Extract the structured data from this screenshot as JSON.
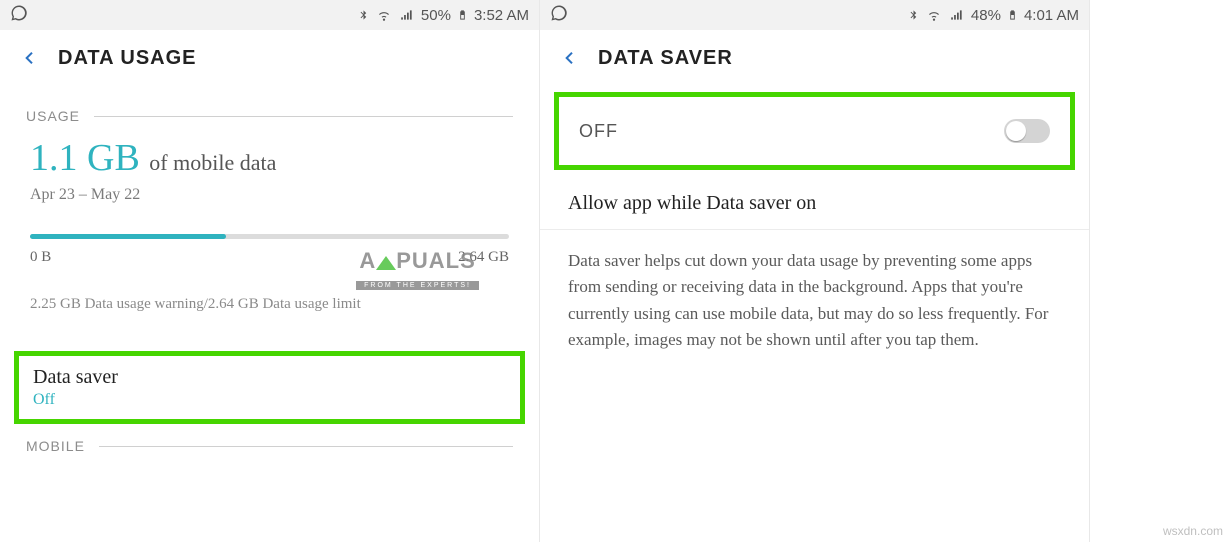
{
  "left": {
    "statusbar": {
      "battery_pct": "50%",
      "time": "3:52 AM"
    },
    "title": "DATA USAGE",
    "sections": {
      "usage_header": "USAGE",
      "mobile_header": "MOBILE"
    },
    "usage": {
      "amount": "1.1 GB",
      "of_label": " of mobile data",
      "range": "Apr 23 – May 22",
      "bar_min": "0 B",
      "bar_max": "2.64 GB",
      "warning_line": "2.25 GB Data usage warning/2.64 GB Data usage limit"
    },
    "data_saver_row": {
      "title": "Data saver",
      "status": "Off"
    }
  },
  "right": {
    "statusbar": {
      "battery_pct": "48%",
      "time": "4:01 AM"
    },
    "title": "DATA SAVER",
    "off_label": "OFF",
    "allow_row": "Allow app while Data saver on",
    "description": "Data saver helps cut down your data usage by preventing some apps from sending or receiving data in the background. Apps that you're currently using can use mobile data, but may do so less frequently. For example, images may not be shown until after you tap them."
  },
  "watermark": {
    "brand": "A  PUALS",
    "tag": "FROM THE EXPERTS!"
  },
  "credit": "wsxdn.com"
}
